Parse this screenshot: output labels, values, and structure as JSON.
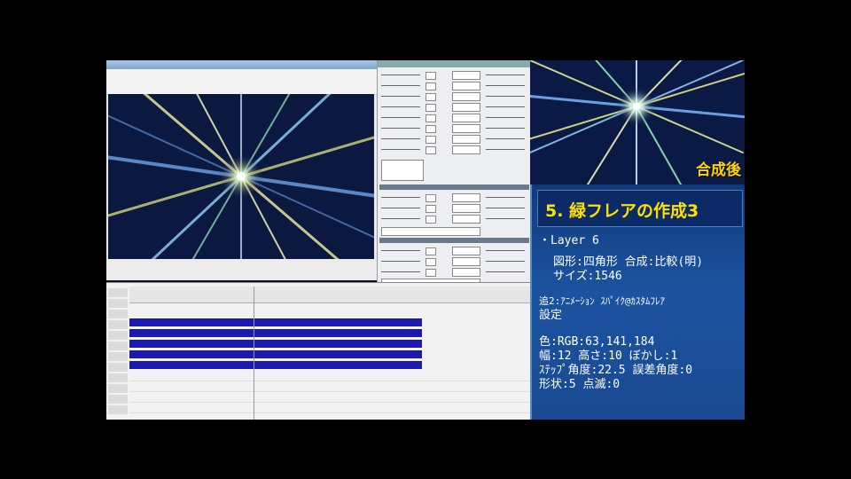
{
  "composite": {
    "label": "合成後"
  },
  "info": {
    "title": "5. 緑フレアの作成3",
    "layer": "・Layer 6",
    "shape_line": "図形:四角形 合成:比較(明)",
    "size_line": "サイズ:1546",
    "add_line": "追2:ｱﾆﾒｰｼｮﾝ ｽﾊﾟｲｸ@ｶｽﾀﾑﾌﾚｱ",
    "setting_line": "設定",
    "color_line": "色:RGB:63,141,184",
    "width_line": "幅:12 高さ:10 ぼかし:1",
    "step_line": "ｽﾃｯﾌﾟ角度:22.5 誤差角度:0",
    "form_line": "形状:5 点滅:0"
  },
  "colors": {
    "accent_title": "#ffe000",
    "composite_label": "#ffd400",
    "panel_bg": "#1b53a0",
    "clip_bg": "#1a1ab0"
  }
}
